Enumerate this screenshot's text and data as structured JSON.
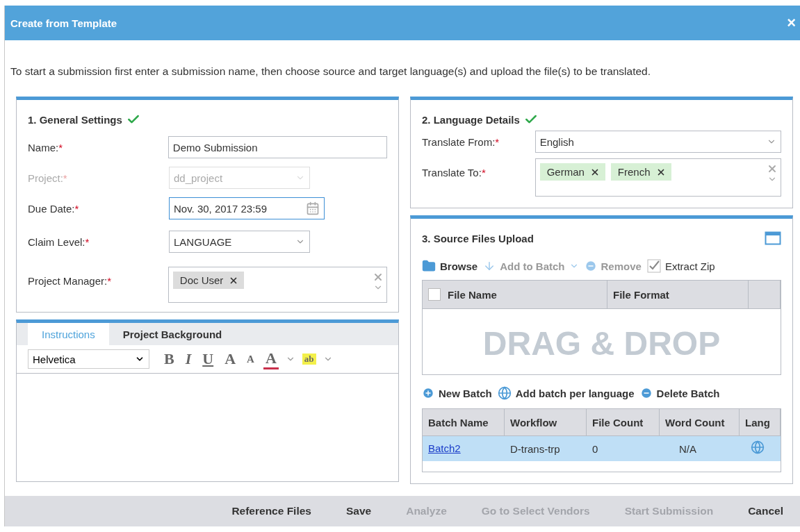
{
  "window": {
    "title": "Create from Template",
    "close": "×"
  },
  "intro": "To start a submission first enter a submission name, then choose source and target language(s) and upload the file(s) to be translated.",
  "general": {
    "title": "1. General Settings",
    "complete": true,
    "fields": [
      {
        "kind": "text",
        "label": "Name:",
        "mark": "*",
        "value": "Demo Submission",
        "disabled": false,
        "focused": false
      },
      {
        "kind": "select",
        "label": "Project:",
        "mark": "*",
        "value": "dd_project",
        "disabled": true,
        "focused": false
      },
      {
        "kind": "date",
        "label": "Due Date:",
        "mark": "*",
        "value": "Nov. 30, 2017 23:59",
        "disabled": false,
        "focused": true
      },
      {
        "kind": "select",
        "label": "Claim Level:",
        "mark": "*",
        "value": "LANGUAGE",
        "disabled": false,
        "focused": false
      },
      {
        "kind": "tags",
        "label": "Project Manager:",
        "mark": "*",
        "tags": [
          "Doc User"
        ],
        "disabled": false,
        "focused": false
      }
    ]
  },
  "editor": {
    "tabs": [
      {
        "label": "Instructions",
        "selected": true
      },
      {
        "label": "Project Background",
        "selected": false
      }
    ],
    "font": "Helvetica",
    "format_buttons": [
      {
        "kind": "bold",
        "glyph": "B"
      },
      {
        "kind": "italic",
        "glyph": "I"
      },
      {
        "kind": "underline",
        "glyph": "U"
      },
      {
        "kind": "grow",
        "glyph": "A"
      },
      {
        "kind": "shrink",
        "glyph": "A"
      },
      {
        "kind": "color",
        "glyph": "A"
      },
      {
        "kind": "highlight",
        "glyph": "ab"
      }
    ]
  },
  "language": {
    "title": "2. Language Details",
    "complete": true,
    "from": {
      "label": "Translate From:",
      "mark": "*",
      "value": "English"
    },
    "to": {
      "label": "Translate To:",
      "mark": "*",
      "tags": [
        "German",
        "French"
      ]
    }
  },
  "upload": {
    "title": "3. Source Files Upload",
    "toolbar": [
      {
        "kind": "folder",
        "label": "Browse",
        "disabled": false
      },
      {
        "kind": "down",
        "label": "Add to Batch",
        "disabled": true
      },
      {
        "kind": "minus",
        "label": "Remove",
        "disabled": true
      },
      {
        "kind": "checkbox",
        "label": "Extract Zip",
        "checked": true
      }
    ],
    "select_all": false,
    "file_columns": [
      "File Name",
      "File Format"
    ],
    "drop_hint": "DRAG & DROP",
    "batch_toolbar": [
      {
        "kind": "plus",
        "label": "New Batch"
      },
      {
        "kind": "globe",
        "label": "Add batch per language"
      },
      {
        "kind": "minus",
        "label": "Delete Batch"
      }
    ],
    "batch_columns": [
      "Batch Name",
      "Workflow",
      "File Count",
      "Word Count",
      "Lang"
    ],
    "batches": [
      {
        "name": "Batch2",
        "workflow": "D-trans-trp",
        "file_count": "0",
        "word_count": "N/A",
        "selected": true
      }
    ]
  },
  "footer": [
    {
      "label": "Reference Files",
      "disabled": false
    },
    {
      "label": "Save",
      "disabled": false
    },
    {
      "label": "Analyze",
      "disabled": true
    },
    {
      "label": "Go to Select Vendors",
      "disabled": true
    },
    {
      "label": "Start Submission",
      "disabled": true
    },
    {
      "label": "Cancel",
      "disabled": false
    }
  ]
}
